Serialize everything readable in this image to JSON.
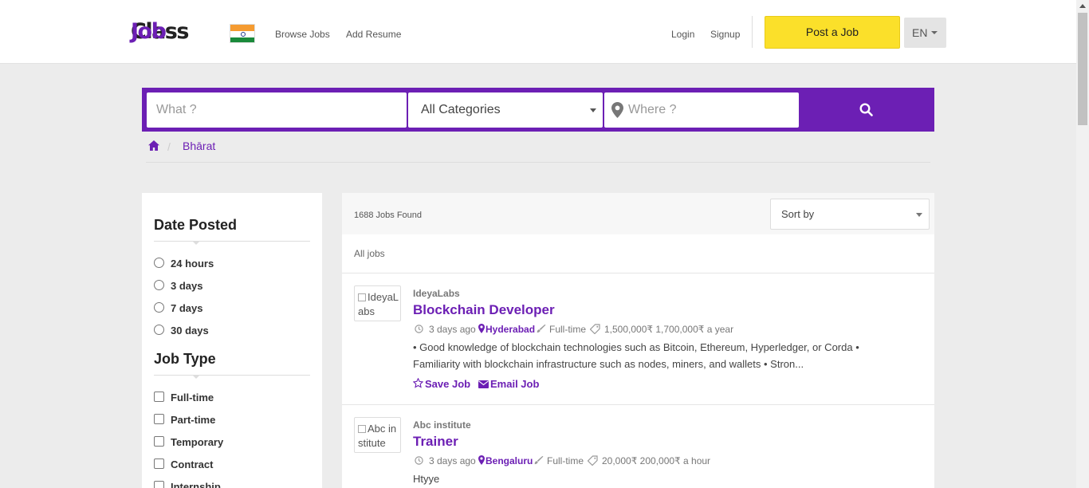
{
  "header": {
    "brand_first": "Job",
    "brand_second": "Class",
    "nav": [
      "Browse Jobs",
      "Add Resume"
    ],
    "login": "Login",
    "signup": "Signup",
    "post_job": "Post a Job",
    "language": "EN"
  },
  "search": {
    "what_placeholder": "What ?",
    "category": "All Categories",
    "where_placeholder": "Where ?"
  },
  "breadcrumb": {
    "current": "Bhārat"
  },
  "filters": {
    "date_posted": {
      "title": "Date Posted",
      "options": [
        "24 hours",
        "3 days",
        "7 days",
        "30 days"
      ]
    },
    "job_type": {
      "title": "Job Type",
      "options": [
        "Full-time",
        "Part-time",
        "Temporary",
        "Contract",
        "Internship"
      ]
    }
  },
  "results": {
    "count": "1688 Jobs Found",
    "sort_label": "Sort by",
    "all_jobs": "All jobs",
    "jobs": [
      {
        "company": "IdeyaLabs",
        "logo_alt": "IdeyaLabs",
        "title": "Blockchain Developer",
        "posted": "3 days ago",
        "location": "Hyderabad",
        "type": "Full-time",
        "salary": "1,500,000₹ 1,700,000₹ a year",
        "description": "• Good knowledge of blockchain technologies such as Bitcoin, Ethereum, Hyperledger, or Corda • Familiarity with blockchain infrastructure such as nodes, miners, and wallets • Stron...",
        "save": "Save Job",
        "email": "Email Job"
      },
      {
        "company": "Abc institute",
        "logo_alt": "Abc institute",
        "title": "Trainer",
        "posted": "3 days ago",
        "location": "Bengaluru",
        "type": "Full-time",
        "salary": "20,000₹ 200,000₹ a hour",
        "description": "Htyye"
      }
    ]
  },
  "colors": {
    "brand": "#6c1fb4",
    "post_button": "#fbe02a"
  }
}
